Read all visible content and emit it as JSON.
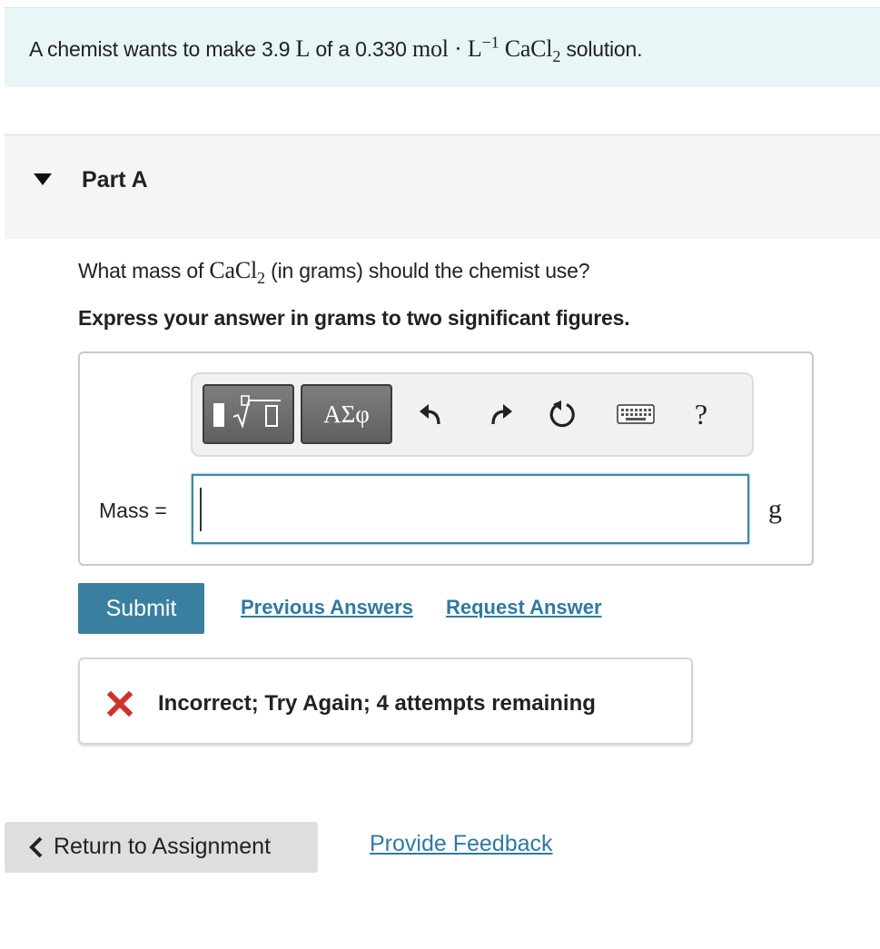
{
  "problem": {
    "prefix": "A chemist wants to make 3.9 ",
    "volume_unit": "L",
    "mid": " of a 0.330 ",
    "conc_unit_base": "mol · L",
    "conc_unit_exp": "−1",
    "compound_base": "CaCl",
    "compound_sub": "2",
    "suffix": " solution."
  },
  "part": {
    "title": "Part A",
    "question_prefix": "What mass of ",
    "question_compound_base": "CaCl",
    "question_compound_sub": "2",
    "question_suffix": " (in grams) should the chemist use?",
    "instruction": "Express your answer in grams to two significant figures."
  },
  "toolbar": {
    "symbols_label": "ΑΣφ",
    "help_label": "?",
    "icons": [
      "templates-icon",
      "undo-icon",
      "redo-icon",
      "reset-icon",
      "keyboard-icon",
      "help-icon"
    ]
  },
  "answer": {
    "label": "Mass =",
    "value": "",
    "unit": "g"
  },
  "actions": {
    "submit": "Submit",
    "previous_answers": "Previous Answers",
    "request_answer": "Request Answer"
  },
  "feedback": {
    "message": "Incorrect; Try Again; 4 attempts remaining",
    "status_color": "#d0312d"
  },
  "footer": {
    "return_label": "Return to Assignment",
    "provide_feedback": "Provide Feedback"
  },
  "colors": {
    "accent": "#3a7f9f",
    "link": "#2f7aa0",
    "banner_bg": "#e9f6f8"
  }
}
